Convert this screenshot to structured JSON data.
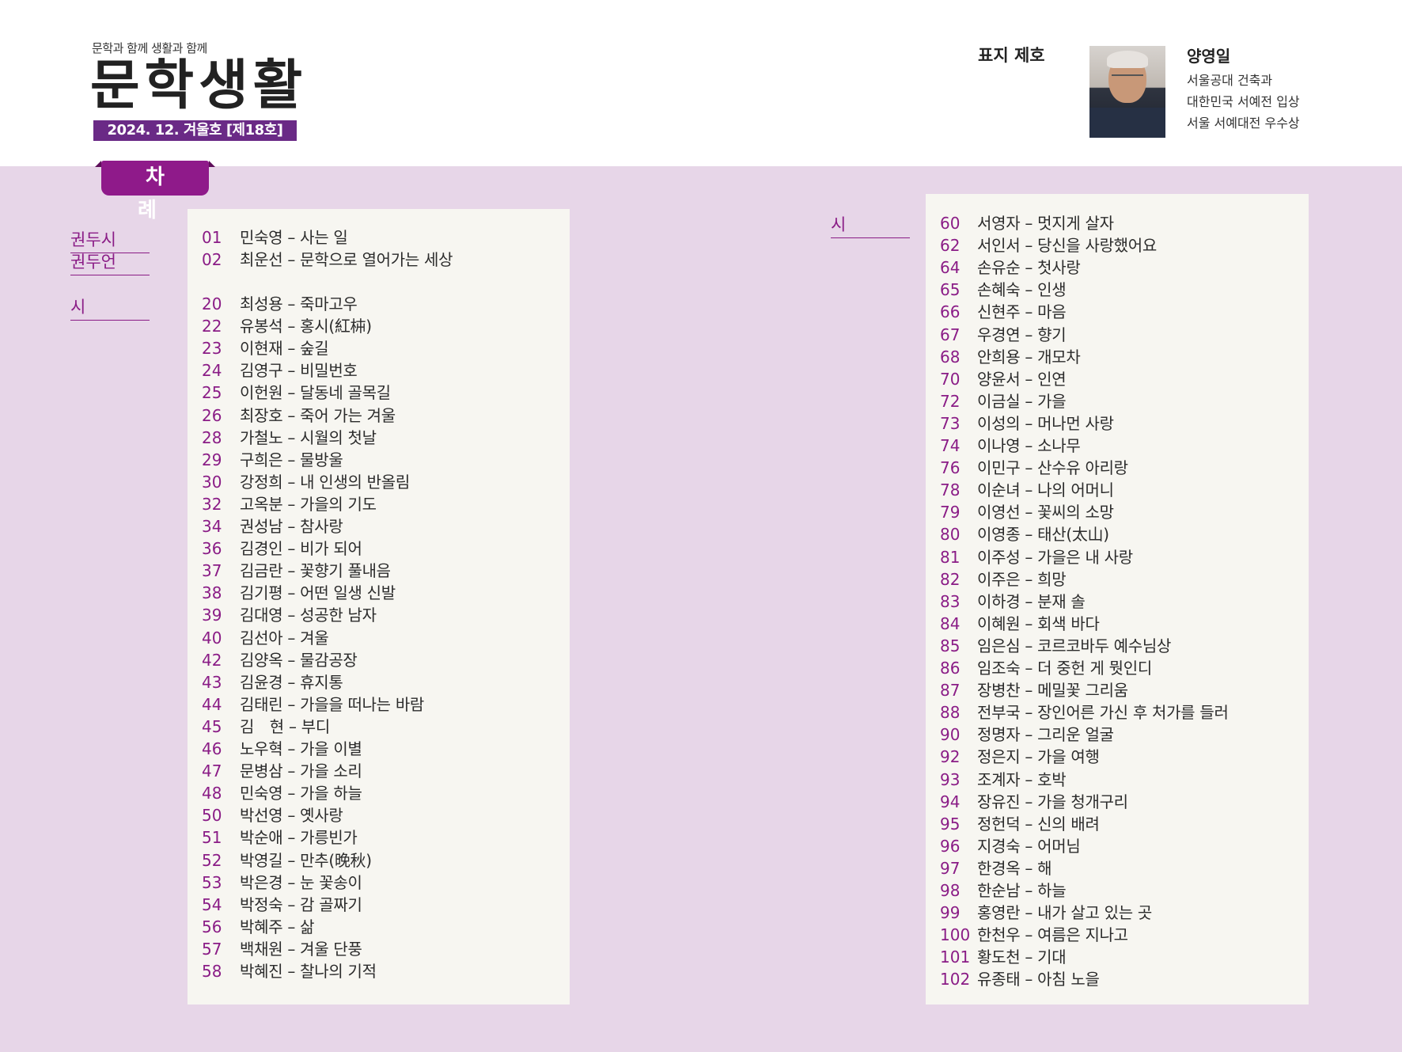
{
  "header": {
    "tagline": "문학과 함께 생활과 함께",
    "logo": "문학생활",
    "issue": "2024. 12. 겨울호 [제18호]"
  },
  "cover": {
    "label": "표지 제호",
    "artist_name": "양영일",
    "artist_lines": [
      "서울공대 건축과",
      "대한민국 서예전 입상",
      "서울 서예대전 우수상"
    ]
  },
  "toc_title": "차 례",
  "categories": {
    "gwondusi": "권두시",
    "gwondueon": "권두언",
    "si_left": "시",
    "si_right": "시"
  },
  "left_entries": [
    {
      "num": "01",
      "text": "민숙영 – 사는 일"
    },
    {
      "num": "02",
      "text": "최운선 – 문학으로 열어가는 세상"
    },
    {
      "num": "20",
      "text": "최성용 – 죽마고우"
    },
    {
      "num": "22",
      "text": "유봉석 – 홍시(紅枾)"
    },
    {
      "num": "23",
      "text": "이현재 – 숲길"
    },
    {
      "num": "24",
      "text": "김영구 – 비밀번호"
    },
    {
      "num": "25",
      "text": "이헌원 – 달동네 골목길"
    },
    {
      "num": "26",
      "text": "최장호 – 죽어 가는 겨울"
    },
    {
      "num": "28",
      "text": "가철노 – 시월의 첫날"
    },
    {
      "num": "29",
      "text": "구희은 – 물방울"
    },
    {
      "num": "30",
      "text": "강정희 – 내 인생의 반올림"
    },
    {
      "num": "32",
      "text": "고옥분 – 가을의 기도"
    },
    {
      "num": "34",
      "text": "권성남 – 참사랑"
    },
    {
      "num": "36",
      "text": "김경인 – 비가 되어"
    },
    {
      "num": "37",
      "text": "김금란 – 꽃향기 풀내음"
    },
    {
      "num": "38",
      "text": "김기평 – 어떤 일생 신발"
    },
    {
      "num": "39",
      "text": "김대영 – 성공한 남자"
    },
    {
      "num": "40",
      "text": "김선아 – 겨울"
    },
    {
      "num": "42",
      "text": "김양옥 – 물감공장"
    },
    {
      "num": "43",
      "text": "김윤경 – 휴지통"
    },
    {
      "num": "44",
      "text": "김태린 – 가을을 떠나는 바람"
    },
    {
      "num": "45",
      "text": "김　현 – 부디"
    },
    {
      "num": "46",
      "text": "노우혁 – 가을 이별"
    },
    {
      "num": "47",
      "text": "문병삼 – 가을 소리"
    },
    {
      "num": "48",
      "text": "민숙영 – 가을 하늘"
    },
    {
      "num": "50",
      "text": "박선영 – 옛사랑"
    },
    {
      "num": "51",
      "text": "박순애 – 가릉빈가"
    },
    {
      "num": "52",
      "text": "박영길 – 만추(晚秋)"
    },
    {
      "num": "53",
      "text": "박은경 – 눈 꽃송이"
    },
    {
      "num": "54",
      "text": "박정숙 – 감 골짜기"
    },
    {
      "num": "56",
      "text": "박혜주 – 삶"
    },
    {
      "num": "57",
      "text": "백채원 – 겨울 단풍"
    },
    {
      "num": "58",
      "text": "박혜진 – 찰나의 기적"
    }
  ],
  "right_entries": [
    {
      "num": "60",
      "text": "서영자 – 멋지게 살자"
    },
    {
      "num": "62",
      "text": "서인서 – 당신을 사랑했어요"
    },
    {
      "num": "64",
      "text": "손유순 – 첫사랑"
    },
    {
      "num": "65",
      "text": "손혜숙 – 인생"
    },
    {
      "num": "66",
      "text": "신현주 – 마음"
    },
    {
      "num": "67",
      "text": "우경연 – 향기"
    },
    {
      "num": "68",
      "text": "안희용 – 개모차"
    },
    {
      "num": "70",
      "text": "양윤서 – 인연"
    },
    {
      "num": "72",
      "text": "이금실 – 가을"
    },
    {
      "num": "73",
      "text": "이성의 – 머나먼 사랑"
    },
    {
      "num": "74",
      "text": "이나영 – 소나무"
    },
    {
      "num": "76",
      "text": "이민구 – 산수유 아리랑"
    },
    {
      "num": "78",
      "text": "이순녀 – 나의 어머니"
    },
    {
      "num": "79",
      "text": "이영선 – 꽃씨의 소망"
    },
    {
      "num": "80",
      "text": "이영종 – 태산(太山)"
    },
    {
      "num": "81",
      "text": "이주성 – 가을은 내 사랑"
    },
    {
      "num": "82",
      "text": "이주은 – 희망"
    },
    {
      "num": "83",
      "text": "이하경 – 분재 솔"
    },
    {
      "num": "84",
      "text": "이혜원 – 회색 바다"
    },
    {
      "num": "85",
      "text": "임은심 – 코르코바두 예수님상"
    },
    {
      "num": "86",
      "text": "임조숙 – 더 중헌 게 뭣인디"
    },
    {
      "num": "87",
      "text": "장병찬 – 메밀꽃 그리움"
    },
    {
      "num": "88",
      "text": "전부국 – 장인어른 가신 후 처가를 들러"
    },
    {
      "num": "90",
      "text": "정명자 – 그리운 얼굴"
    },
    {
      "num": "92",
      "text": "정은지 – 가을 여행"
    },
    {
      "num": "93",
      "text": "조계자 – 호박"
    },
    {
      "num": "94",
      "text": "장유진 – 가을 청개구리"
    },
    {
      "num": "95",
      "text": "정헌덕 – 신의 배려"
    },
    {
      "num": "96",
      "text": "지경숙 – 어머님"
    },
    {
      "num": "97",
      "text": "한경옥 – 해"
    },
    {
      "num": "98",
      "text": "한순남 – 하늘"
    },
    {
      "num": "99",
      "text": "홍영란 – 내가 살고 있는 곳"
    },
    {
      "num": "100",
      "text": "한천우 – 여름은 지나고"
    },
    {
      "num": "101",
      "text": "황도천 – 기대"
    },
    {
      "num": "102",
      "text": "유종태 – 아침 노을"
    }
  ],
  "colors": {
    "accent": "#8a1c86",
    "issue_bg": "#6a2a86",
    "tab_bg": "#8f1a8a",
    "page_bg": "#e7d6e8",
    "panel_bg": "#f7f6f1"
  }
}
